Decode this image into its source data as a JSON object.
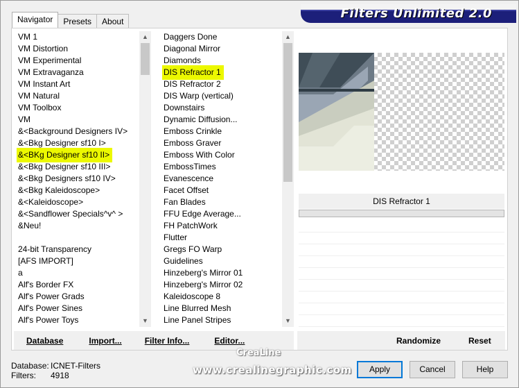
{
  "app": {
    "title": "Filters Unlimited 2.0"
  },
  "tabs": [
    {
      "label": "Navigator"
    },
    {
      "label": "Presets"
    },
    {
      "label": "About"
    }
  ],
  "categories": {
    "items": [
      "VM 1",
      "VM Distortion",
      "VM Experimental",
      "VM Extravaganza",
      "VM Instant Art",
      "VM Natural",
      "VM Toolbox",
      "VM",
      "&<Background Designers IV>",
      "&<Bkg Designer sf10 I>",
      "&<BKg Designer sf10 II>",
      "&<Bkg Designer sf10 III>",
      "&<Bkg Designers sf10 IV>",
      "&<Bkg Kaleidoscope>",
      "&<Kaleidoscope>",
      "&<Sandflower Specials^v^ >",
      "&Neu!",
      "",
      "24-bit Transparency",
      "[AFS IMPORT]",
      "a",
      "Alf's Border FX",
      "Alf's Power Grads",
      "Alf's Power Sines",
      "Alf's Power Toys"
    ],
    "selected_index": 10
  },
  "filters": {
    "items": [
      "Daggers Done",
      "Diagonal Mirror",
      "Diamonds",
      "DIS Refractor 1",
      "DIS Refractor 2",
      "DIS Warp (vertical)",
      "Downstairs",
      "Dynamic Diffusion...",
      "Emboss Crinkle",
      "Emboss Graver",
      "Emboss With Color",
      "EmbossTimes",
      "Evanescence",
      "Facet Offset",
      "Fan Blades",
      "FFU Edge Average...",
      "FH PatchWork",
      "Flutter",
      "Gregs FO Warp",
      "Guidelines",
      "Hinzeberg's Mirror 01",
      "Hinzeberg's Mirror 02",
      "Kaleidoscope 8",
      "Line Blurred Mesh",
      "Line Panel Stripes"
    ],
    "selected_index": 3,
    "marked_indices": [
      4,
      17,
      19
    ]
  },
  "toolbar": {
    "database": "Database",
    "import": "Import...",
    "filter_info": "Filter Info...",
    "editor": "Editor...",
    "randomize": "Randomize",
    "reset": "Reset"
  },
  "preview": {
    "filter_name": "DIS Refractor 1"
  },
  "status": {
    "database_label": "Database:",
    "database_value": "ICNET-Filters",
    "filters_label": "Filters:",
    "filters_value": "4918"
  },
  "dialog_buttons": {
    "apply": "Apply",
    "cancel": "Cancel",
    "help": "Help"
  },
  "watermark": {
    "line1": "CreaLine",
    "line2": "www.crealinegraphic.com"
  },
  "colors": {
    "selection_highlight": "#ecf800",
    "logo_bg": "#1c1f7a",
    "default_button_border": "#0078d7"
  }
}
